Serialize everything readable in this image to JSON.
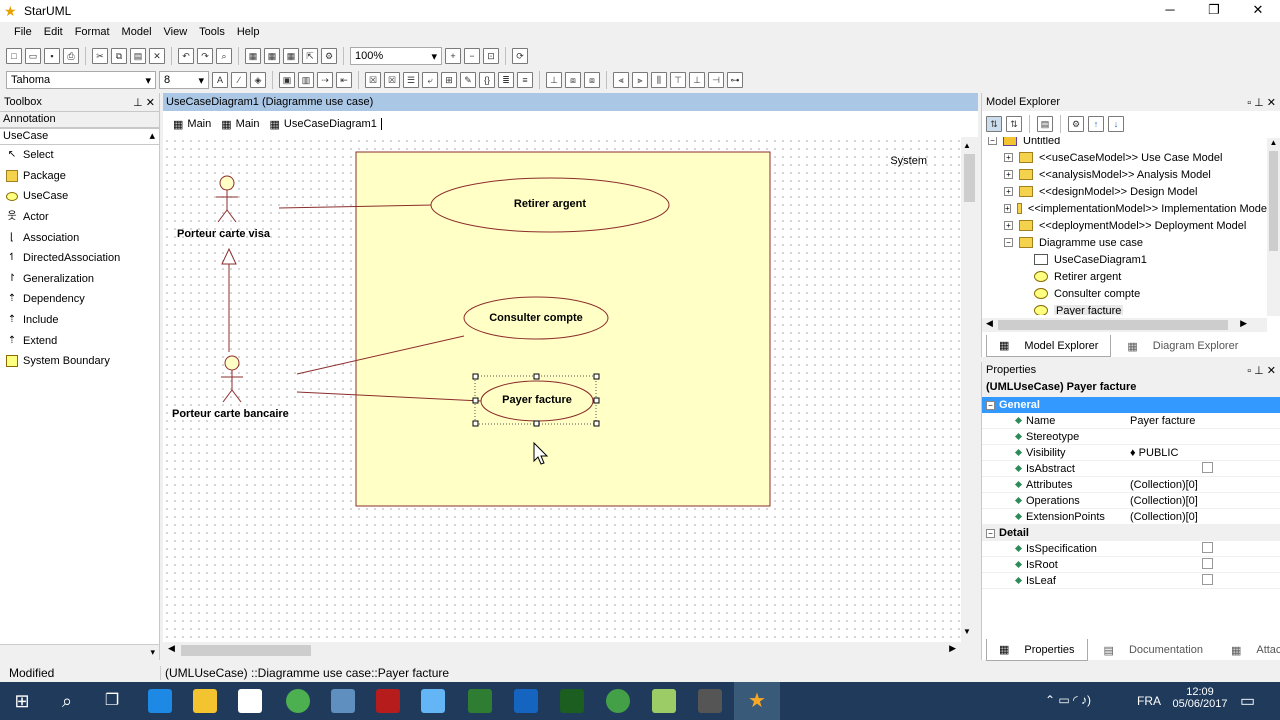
{
  "window": {
    "title": "StarUML"
  },
  "menu": [
    "File",
    "Edit",
    "Format",
    "Model",
    "View",
    "Tools",
    "Help"
  ],
  "toolbar": {
    "zoom": "100%",
    "font": "Tahoma",
    "font_size": "8"
  },
  "toolbox": {
    "title": "Toolbox",
    "sections": {
      "annotation": "Annotation",
      "usecase": "UseCase"
    },
    "items": [
      "Select",
      "Package",
      "UseCase",
      "Actor",
      "Association",
      "DirectedAssociation",
      "Generalization",
      "Dependency",
      "Include",
      "Extend",
      "System Boundary"
    ]
  },
  "diagram": {
    "title": "UseCaseDiagram1 (Diagramme use case)",
    "tabs": [
      "Main",
      "Main",
      "UseCaseDiagram1"
    ],
    "system_label": "System",
    "actors": [
      "Porteur carte visa",
      "Porteur carte bancaire"
    ],
    "usecases": [
      "Retirer argent",
      "Consulter compte",
      "Payer facture"
    ]
  },
  "explorer": {
    "title": "Model Explorer",
    "items": [
      "Untitled",
      "<<useCaseModel>> Use Case Model",
      "<<analysisModel>> Analysis Model",
      "<<designModel>> Design Model",
      "<<implementationModel>> Implementation Mode",
      "<<deploymentModel>> Deployment Model",
      "Diagramme use case",
      "UseCaseDiagram1",
      "Retirer argent",
      "Consulter compte",
      "Payer facture"
    ],
    "tabs": [
      "Model Explorer",
      "Diagram Explorer"
    ]
  },
  "properties": {
    "title": "Properties",
    "header": "(UMLUseCase) Payer facture",
    "group_general": "General",
    "group_detail": "Detail",
    "general": [
      {
        "name": "Name",
        "value": "Payer facture"
      },
      {
        "name": "Stereotype",
        "value": ""
      },
      {
        "name": "Visibility",
        "value": "PUBLIC"
      },
      {
        "name": "IsAbstract",
        "value": ""
      },
      {
        "name": "Attributes",
        "value": "(Collection)[0]"
      },
      {
        "name": "Operations",
        "value": "(Collection)[0]"
      },
      {
        "name": "ExtensionPoints",
        "value": "(Collection)[0]"
      }
    ],
    "detail": [
      "IsSpecification",
      "IsRoot",
      "IsLeaf"
    ],
    "tabs": [
      "Properties",
      "Documentation",
      "Attachments"
    ]
  },
  "status": {
    "left": "Modified",
    "path": "(UMLUseCase) ::Diagramme use case::Payer facture"
  },
  "taskbar": {
    "lang": "FRA",
    "time": "12:09",
    "date": "05/06/2017"
  }
}
